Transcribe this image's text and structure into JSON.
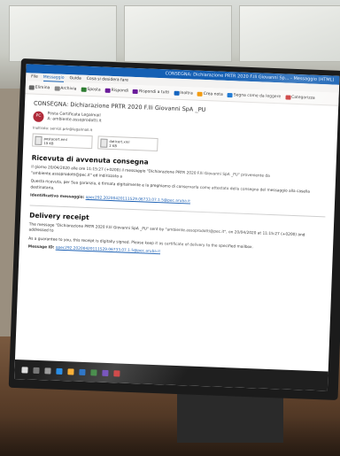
{
  "window": {
    "title": "CONSEGNA: Dichiarazione PRTR 2020 F.lli Giovanni Sp... - Messaggio (HTML)",
    "menu": [
      "File",
      "Messaggio",
      "Guida",
      "Cosa si desidera fare"
    ]
  },
  "ribbon": {
    "items": [
      "Elimina",
      "Archivia",
      "Sposta",
      "Rispondi",
      "Rispondi a tutti",
      "Inoltra",
      "Crea nota",
      "Segna come da leggere",
      "Categorizza"
    ]
  },
  "mail": {
    "subject": "CONSEGNA: Dichiarazione PRTR 2020 F.lli Giovanni SpA _PU",
    "sender_initials": "PC",
    "sender_name": "Posta Certificata Legalmail",
    "sender_line2": "A: ambiente.assoprodotti.it",
    "recipients": "Inoltrato: servizi.prtr@legalmail.it",
    "attachments": [
      {
        "name": "postacert.eml",
        "size": "19 KB"
      },
      {
        "name": "daticert.xml",
        "size": "2 KB"
      }
    ],
    "heading_it": "Ricevuta di avvenuta consegna",
    "para_it_1": "Il giorno 20/04/2020 alle ore 11:15:27 (+0200) il messaggio \"Dichiarazione PRTR 2020 F.lli Giovanni SpA _PU\" proveniente da \"ambiente.assoprodotti@pec.it\" ed indirizzato a",
    "para_it_2": "Questa ricevuta, per Sua garanzia, è firmata digitalmente e la preghiamo di conservarla come attestato della consegna del messaggio alla casella destinataria.",
    "id_label_it": "Identificativo messaggio:",
    "id_value_it": "opec292.20200420111529.06733.07.1.5@pec.aruba.it",
    "heading_en": "Delivery receipt",
    "para_en_1": "The message \"Dichiarazione PRTR 2020 F.lli Giovanni SpA _PU\" sent by \"ambiente.assoprodotti@pec.it\", on 20/04/2020 at 11:15:27 (+0200) and addressed to",
    "para_en_2": "As a guarantee to you, this receipt is digitally signed. Please keep it as certificate of delivery to the specified mailbox.",
    "id_label_en": "Message ID:",
    "id_value_en": "opec292.20200420111529.06733.07.1.5@pec.aruba.it"
  },
  "colors": {
    "titlebar": "#1560b4",
    "link": "#1a5fb4",
    "avatar": "#b02b3a"
  }
}
